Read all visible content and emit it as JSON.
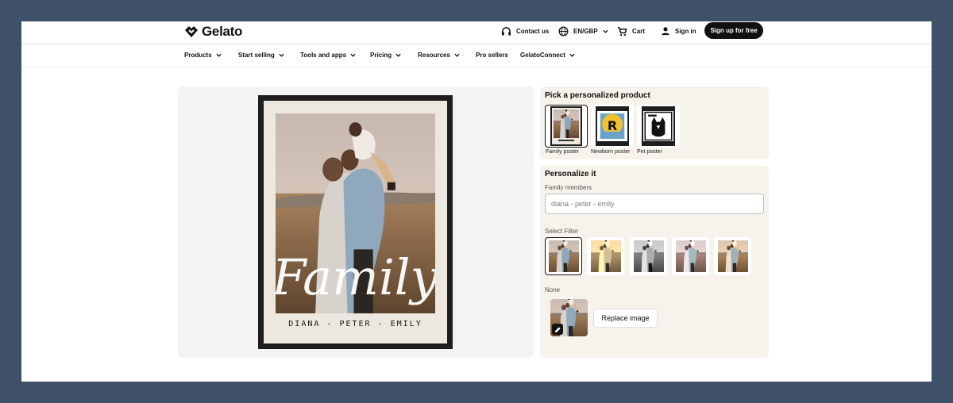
{
  "brand": {
    "name": "Gelato"
  },
  "utility_bar": {
    "contact_label": "Contact us",
    "language_label": "EN/GBP",
    "cart_label": "Cart",
    "signin_label": "Sign in",
    "signup_label": "Sign up for free"
  },
  "nav": {
    "items": [
      {
        "label": "Products",
        "has_dropdown": true
      },
      {
        "label": "Start selling",
        "has_dropdown": true
      },
      {
        "label": "Tools and apps",
        "has_dropdown": true
      },
      {
        "label": "Pricing",
        "has_dropdown": true
      },
      {
        "label": "Resources",
        "has_dropdown": true
      },
      {
        "label": "Pro sellers",
        "has_dropdown": false
      },
      {
        "label": "GelatoConnect",
        "has_dropdown": true
      }
    ]
  },
  "preview": {
    "poster_script": "Family",
    "poster_names": "DIANA - PETER - EMILY"
  },
  "product_picker": {
    "title": "Pick a personalized product",
    "products": [
      {
        "label": "Family poster",
        "selected": true
      },
      {
        "label": "Newborn poster",
        "selected": false,
        "initial": "R"
      },
      {
        "label": "Pet poster",
        "selected": false
      }
    ]
  },
  "personalize": {
    "title": "Personalize it",
    "family_members_label": "Family members",
    "family_members_value": "diana - peter - emily",
    "filter_label": "Select Filter",
    "filters": [
      {
        "name": "original",
        "selected": true
      },
      {
        "name": "sepia",
        "selected": false
      },
      {
        "name": "black-and-white",
        "selected": false
      },
      {
        "name": "cool",
        "selected": false
      },
      {
        "name": "warm",
        "selected": false
      }
    ],
    "selected_filter_label": "None",
    "replace_image_label": "Replace image"
  },
  "colors": {
    "page_background": "#3f5069",
    "accent": "#111111",
    "panel_background": "#f6f3ec"
  }
}
